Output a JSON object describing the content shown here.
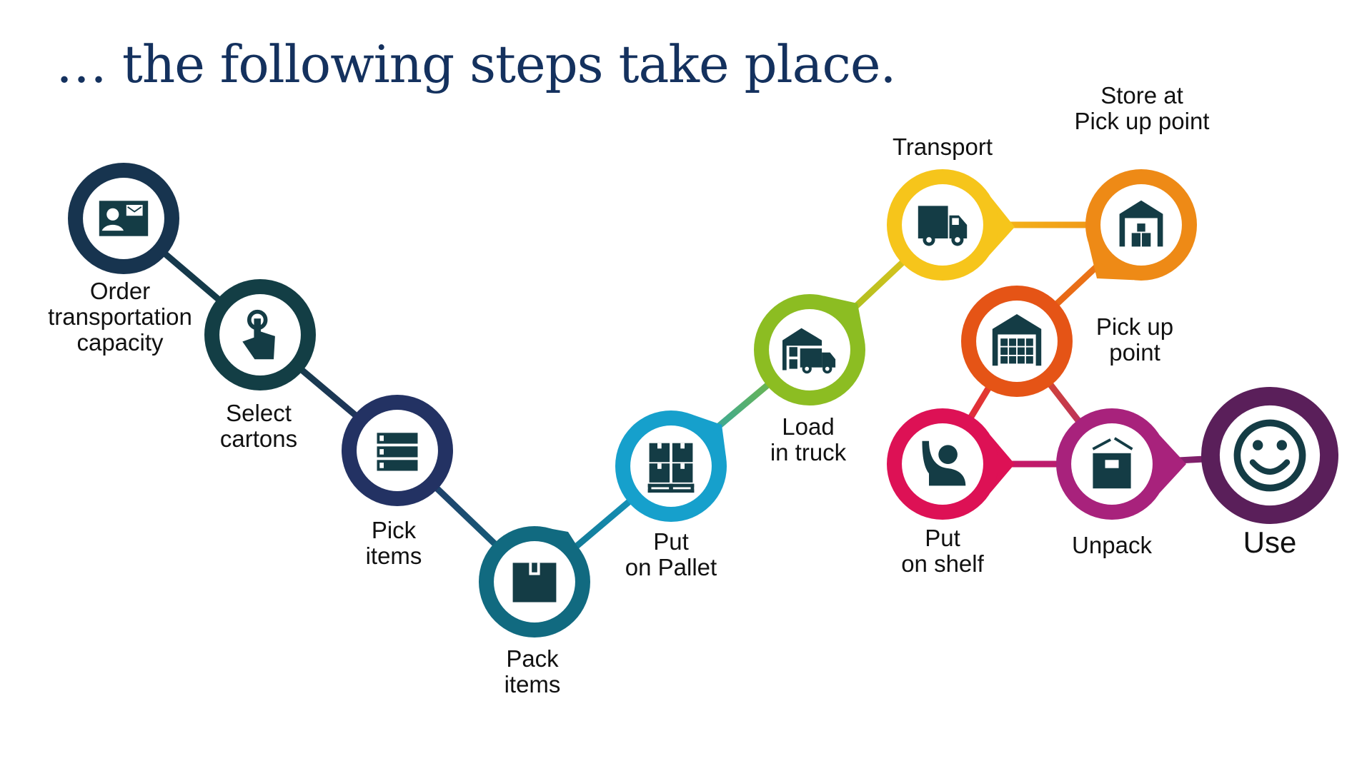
{
  "title": "… the following steps take place.",
  "steps": [
    {
      "id": "order",
      "lines": [
        "Order",
        "transportation",
        "capacity"
      ],
      "icon": "contact-card-icon",
      "color": "#17344f"
    },
    {
      "id": "select",
      "lines": [
        "Select",
        "cartons"
      ],
      "icon": "touch-hand-icon",
      "color": "#133e45"
    },
    {
      "id": "pick",
      "lines": [
        "Pick",
        "items"
      ],
      "icon": "storage-list-icon",
      "color": "#233263"
    },
    {
      "id": "pack",
      "lines": [
        "Pack",
        "items"
      ],
      "icon": "box-icon",
      "color": "#116a80"
    },
    {
      "id": "pallet",
      "lines": [
        "Put",
        "on Pallet"
      ],
      "icon": "pallet-icon",
      "color": "#16a0cc"
    },
    {
      "id": "load",
      "lines": [
        "Load",
        "in truck"
      ],
      "icon": "warehouse-truck-icon",
      "color": "#8cbd22"
    },
    {
      "id": "transport",
      "lines": [
        "Transport"
      ],
      "icon": "truck-icon",
      "color": "#f6c51b"
    },
    {
      "id": "store",
      "lines": [
        "Store at",
        "Pick up point"
      ],
      "icon": "warehouse-boxes-icon",
      "color": "#ee8a16"
    },
    {
      "id": "pickup",
      "lines": [
        "Pick up",
        "point"
      ],
      "icon": "warehouse-shelves-icon",
      "color": "#e55416"
    },
    {
      "id": "shelf",
      "lines": [
        "Put",
        "on shelf"
      ],
      "icon": "person-reach-icon",
      "color": "#dd1155"
    },
    {
      "id": "unpack",
      "lines": [
        "Unpack"
      ],
      "icon": "open-box-icon",
      "color": "#a8227c"
    },
    {
      "id": "use",
      "lines": [
        "Use"
      ],
      "icon": "smiley-icon",
      "color": "#5a1f5a"
    }
  ],
  "connections": [
    [
      "order",
      "select"
    ],
    [
      "select",
      "pick"
    ],
    [
      "pick",
      "pack"
    ],
    [
      "pack",
      "pallet"
    ],
    [
      "pallet",
      "load"
    ],
    [
      "load",
      "transport"
    ],
    [
      "transport",
      "store"
    ],
    [
      "store",
      "pickup"
    ],
    [
      "pickup",
      "shelf"
    ],
    [
      "pickup",
      "unpack"
    ],
    [
      "shelf",
      "unpack"
    ],
    [
      "unpack",
      "use"
    ]
  ],
  "icon_color": "#143c45"
}
